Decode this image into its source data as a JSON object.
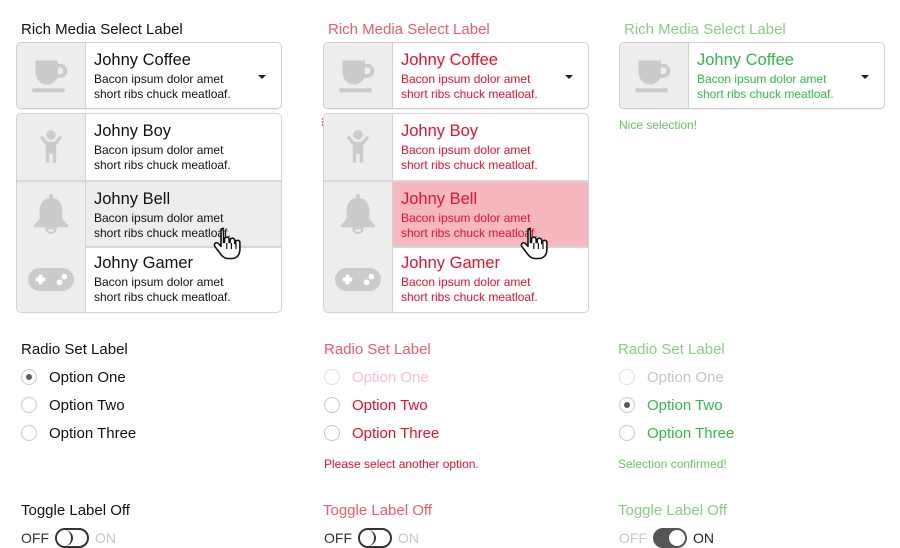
{
  "colors": {
    "default_text": "#111111",
    "error_label": "#ee5a6e",
    "error_text": "#e8112d",
    "error_highlight": "#f6b7bf",
    "success_label": "#8ccc86",
    "success_text": "#33b84a",
    "disabled_text": "#c4c4c4",
    "error_disabled_text": "#f7c1c8",
    "icon_gray": "#cbcbcb"
  },
  "columns": [
    {
      "state": "default",
      "select": {
        "label": "Rich Media Select Label",
        "selected": {
          "icon": "coffee-cup-icon",
          "title": "Johny Coffee",
          "desc1": "Bacon ipsum dolor amet",
          "desc2": "short ribs chuck meatloaf."
        },
        "open": true,
        "options": [
          {
            "icon": "child-icon",
            "title": "Johny Boy",
            "desc1": "Bacon ipsum dolor amet",
            "desc2": "short ribs chuck meatloaf."
          },
          {
            "icon": "bell-icon",
            "title": "Johny Bell",
            "desc1": "Bacon ipsum dolor amet",
            "desc2": "short ribs chuck meatloaf.",
            "hovered": true
          },
          {
            "icon": "gamepad-icon",
            "title": "Johny Gamer",
            "desc1": "Bacon ipsum dolor amet",
            "desc2": "short ribs chuck meatloaf."
          }
        ]
      },
      "radio": {
        "label": "Radio Set Label",
        "options": [
          {
            "label": "Option One",
            "checked": true,
            "disabled": false
          },
          {
            "label": "Option Two",
            "checked": false,
            "disabled": false
          },
          {
            "label": "Option Three",
            "checked": false,
            "disabled": false
          }
        ]
      },
      "toggle": {
        "label": "Toggle Label Off",
        "off_text": "OFF",
        "on_text": "ON",
        "on": false
      }
    },
    {
      "state": "error",
      "select": {
        "label": "Rich Media Select Label",
        "selected": {
          "icon": "coffee-cup-icon",
          "title": "Johny Coffee",
          "desc1": "Bacon ipsum dolor amet",
          "desc2": "short ribs chuck meatloaf."
        },
        "open": true,
        "options": [
          {
            "icon": "child-icon",
            "title": "Johny Boy",
            "desc1": "Bacon ipsum dolor amet",
            "desc2": "short ribs chuck meatloaf."
          },
          {
            "icon": "bell-icon",
            "title": "Johny Bell",
            "desc1": "Bacon ipsum dolor amet",
            "desc2": "short ribs chuck meatloaf.",
            "hovered": true
          },
          {
            "icon": "gamepad-icon",
            "title": "Johny Gamer",
            "desc1": "Bacon ipsum dolor amet",
            "desc2": "short ribs chuck meatloaf."
          }
        ]
      },
      "radio": {
        "label": "Radio Set Label",
        "options": [
          {
            "label": "Option One",
            "checked": false,
            "disabled": true
          },
          {
            "label": "Option Two",
            "checked": false,
            "disabled": false
          },
          {
            "label": "Option Three",
            "checked": false,
            "disabled": false
          }
        ],
        "help": "Please select another option."
      },
      "toggle": {
        "label": "Toggle Label Off",
        "off_text": "OFF",
        "on_text": "ON",
        "on": false
      }
    },
    {
      "state": "success",
      "select": {
        "label": "Rich Media Select Label",
        "selected": {
          "icon": "coffee-cup-icon",
          "title": "Johny Coffee",
          "desc1": "Bacon ipsum dolor amet",
          "desc2": "short ribs chuck meatloaf."
        },
        "open": false,
        "help": "Nice selection!"
      },
      "radio": {
        "label": "Radio Set Label",
        "options": [
          {
            "label": "Option One",
            "checked": false,
            "disabled": true
          },
          {
            "label": "Option Two",
            "checked": true,
            "disabled": false
          },
          {
            "label": "Option Three",
            "checked": false,
            "disabled": false
          }
        ],
        "help": "Selection confirmed!"
      },
      "toggle": {
        "label": "Toggle Label Off",
        "off_text": "OFF",
        "on_text": "ON",
        "on": true
      }
    }
  ]
}
